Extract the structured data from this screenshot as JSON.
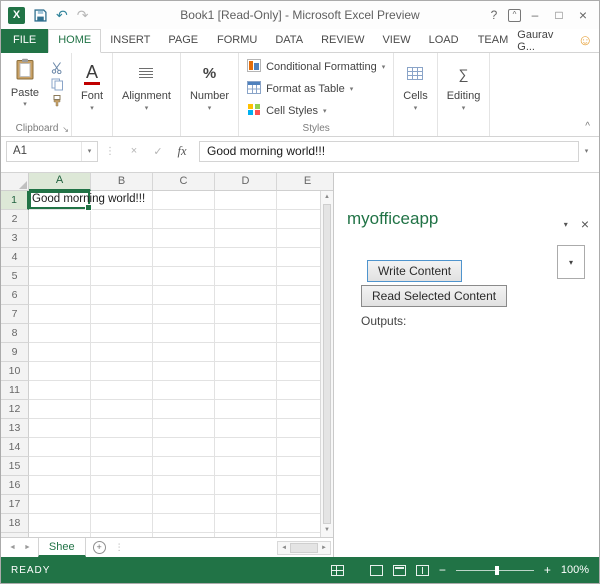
{
  "app": {
    "icon_letter": "X"
  },
  "glyphs": {
    "dropdown": "▾",
    "up_arrow": "▲",
    "down_arrow": "▼",
    "left_arrow": "◄",
    "right_arrow": "►",
    "close": "×",
    "check": "✓",
    "cancel": "×",
    "minimize": "–",
    "maximize": "□",
    "help": "?",
    "ribbon_display": "^",
    "undo": "↶",
    "redo": "↷",
    "dots": "⋮",
    "smiley": "☺",
    "launcher": "↘",
    "collapse": "^",
    "font_a": "A",
    "percent": "%",
    "sigma": "∑",
    "plus": "+",
    "minus": "−"
  },
  "title_bar": {
    "title": "Book1  [Read-Only] - Microsoft Excel Preview"
  },
  "ribbon_tabs": {
    "items": [
      {
        "label": "FILE"
      },
      {
        "label": "HOME"
      },
      {
        "label": "INSERT"
      },
      {
        "label": "PAGE L"
      },
      {
        "label": "FORMU"
      },
      {
        "label": "DATA"
      },
      {
        "label": "REVIEW"
      },
      {
        "label": "VIEW"
      },
      {
        "label": "LOAD T"
      },
      {
        "label": "TEAM"
      }
    ],
    "active": "HOME",
    "user": "Gaurav G..."
  },
  "ribbon": {
    "paste_label": "Paste",
    "clipboard_label": "Clipboard",
    "font_label": "Font",
    "alignment_label": "Alignment",
    "number_label": "Number",
    "styles": {
      "items": [
        "Conditional Formatting",
        "Format as Table",
        "Cell Styles"
      ],
      "label": "Styles"
    },
    "cells_label": "Cells",
    "editing_label": "Editing"
  },
  "formula_bar": {
    "name_box": "A1",
    "fx": "fx",
    "value": "Good morning world!!!"
  },
  "grid": {
    "columns": [
      "A",
      "B",
      "C",
      "D",
      "E"
    ],
    "row_count": 19,
    "active_cell": {
      "ref": "A1",
      "text": "Good morning world!!!"
    }
  },
  "task_pane": {
    "title": "myofficeapp",
    "write_button": "Write Content",
    "read_button": "Read Selected Content",
    "outputs_label": "Outputs:"
  },
  "sheet_bar": {
    "active_tab": "Shee"
  },
  "status_bar": {
    "status": "READY",
    "zoom": "100%"
  }
}
